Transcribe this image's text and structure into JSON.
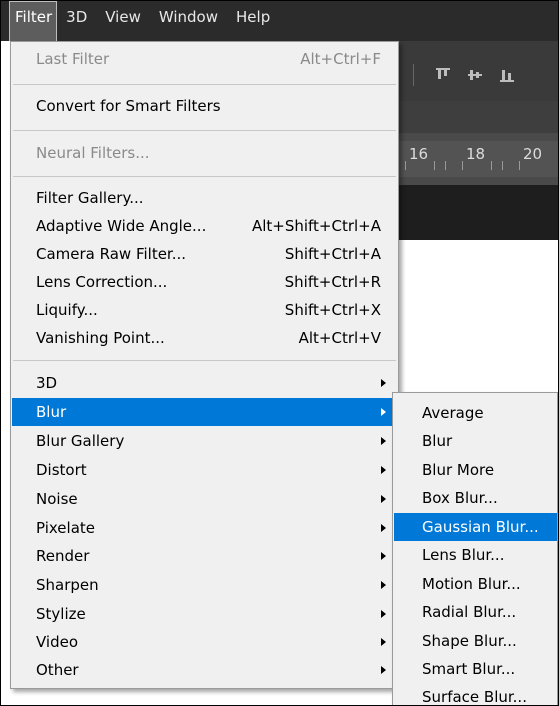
{
  "menubar": {
    "items": [
      "Filter",
      "3D",
      "View",
      "Window",
      "Help"
    ]
  },
  "background": {
    "ruler_numbers": [
      "16",
      "18",
      "20"
    ]
  },
  "filter_menu": {
    "items": [
      {
        "label": "Last Filter",
        "shortcut": "Alt+Ctrl+F",
        "disabled": true
      },
      {
        "label": "Convert for Smart Filters",
        "shortcut": ""
      },
      {
        "label": "Neural Filters...",
        "shortcut": "",
        "disabled": true
      },
      {
        "label": "Filter Gallery...",
        "shortcut": ""
      },
      {
        "label": "Adaptive Wide Angle...",
        "shortcut": "Alt+Shift+Ctrl+A"
      },
      {
        "label": "Camera Raw Filter...",
        "shortcut": "Shift+Ctrl+A"
      },
      {
        "label": "Lens Correction...",
        "shortcut": "Shift+Ctrl+R"
      },
      {
        "label": "Liquify...",
        "shortcut": "Shift+Ctrl+X"
      },
      {
        "label": "Vanishing Point...",
        "shortcut": "Alt+Ctrl+V"
      },
      {
        "label": "3D",
        "submenu": true
      },
      {
        "label": "Blur",
        "submenu": true,
        "highlighted": true
      },
      {
        "label": "Blur Gallery",
        "submenu": true
      },
      {
        "label": "Distort",
        "submenu": true
      },
      {
        "label": "Noise",
        "submenu": true
      },
      {
        "label": "Pixelate",
        "submenu": true
      },
      {
        "label": "Render",
        "submenu": true
      },
      {
        "label": "Sharpen",
        "submenu": true
      },
      {
        "label": "Stylize",
        "submenu": true
      },
      {
        "label": "Video",
        "submenu": true
      },
      {
        "label": "Other",
        "submenu": true
      }
    ]
  },
  "blur_submenu": {
    "items": [
      {
        "label": "Average"
      },
      {
        "label": "Blur"
      },
      {
        "label": "Blur More"
      },
      {
        "label": "Box Blur..."
      },
      {
        "label": "Gaussian Blur...",
        "highlighted": true
      },
      {
        "label": "Lens Blur..."
      },
      {
        "label": "Motion Blur..."
      },
      {
        "label": "Radial Blur..."
      },
      {
        "label": "Shape Blur..."
      },
      {
        "label": "Smart Blur..."
      },
      {
        "label": "Surface Blur..."
      }
    ]
  },
  "colors": {
    "highlight": "#0078d7",
    "menu_bg": "#f0f0f0",
    "menubar_bg": "#2b2b2b",
    "disabled_text": "#8a8a8a"
  }
}
